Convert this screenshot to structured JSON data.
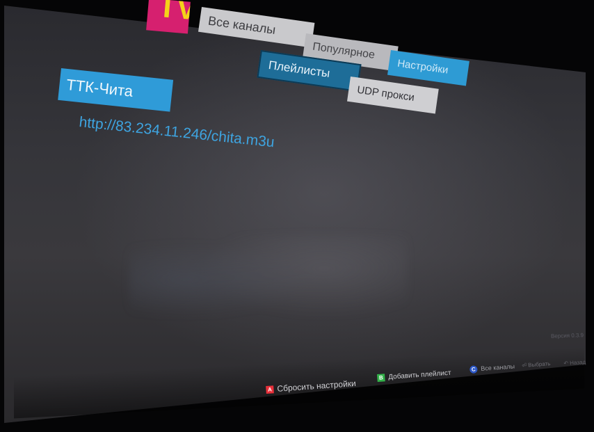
{
  "app": {
    "logo_text": "TV",
    "logo_color": "#d6206f",
    "logo_letter_color": "#f4d21a"
  },
  "tabs": {
    "all_channels": "Все каналы",
    "popular": "Популярное",
    "settings": "Настройки"
  },
  "settings_tabs": {
    "playlists": "Плейлисты",
    "udp_proxy": "UDP прокси"
  },
  "playlist": {
    "name": "ТТК-Чита",
    "url": "http://83.234.11.246/chita.m3u"
  },
  "footer": {
    "version": "Версия 0.3.9",
    "reset_key": "A",
    "reset_label": "Сбросить настройки",
    "add_key": "B",
    "add_label": "Добавить плейлист",
    "all_key": "C",
    "all_label": "Все каналы",
    "select_label": "Выбрать",
    "back_label": "Назад"
  },
  "colors": {
    "accent": "#2f9bd8",
    "selected_subtab": "#1e6d98",
    "url": "#3ea4e0"
  }
}
